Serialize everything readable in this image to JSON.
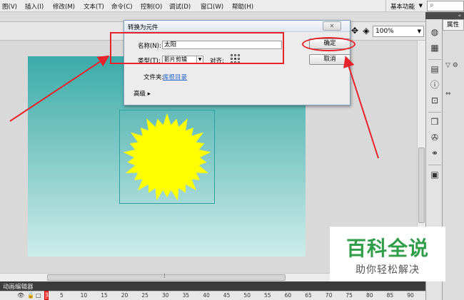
{
  "menu": {
    "items": [
      "图(V)",
      "插入(I)",
      "修改(M)",
      "文本(T)",
      "命令(C)",
      "控制(O)",
      "调试(D)",
      "窗口(W)",
      "帮助(H)"
    ],
    "workspace": "基本功能",
    "search_icon": "magnifier-icon"
  },
  "edit_bar": {
    "zoom": "100%",
    "icons": [
      "edit-symbol-icon",
      "edit-scene-icon"
    ]
  },
  "stage": {
    "gradient": [
      "#3aaba8",
      "#cdecea"
    ],
    "sun_color": "#ffff00"
  },
  "dialog": {
    "title": "转换为元件",
    "close": "✕",
    "name_label": "名称(N):",
    "name_value": "太阳",
    "type_label": "类型(T):",
    "type_value": "影片剪辑",
    "align_label": "对齐:",
    "folder_label": "文件夹:",
    "folder_link": "库根目录",
    "advanced": "高级",
    "ok": "确定",
    "cancel": "取消"
  },
  "timeline": {
    "title": "动画编辑器",
    "ticks": [
      "5",
      "10",
      "15",
      "20",
      "25",
      "30",
      "35",
      "40",
      "45",
      "50",
      "55",
      "60",
      "65",
      "70",
      "75",
      "80",
      "85",
      "90"
    ],
    "first_frame": "1"
  },
  "panels": {
    "properties_tab": "属性",
    "collapse": "«"
  },
  "watermark": {
    "title": "百科全说",
    "subtitle": "助你轻松解决",
    "color": "#2f9e48"
  },
  "annotation_color": "#e8232b"
}
